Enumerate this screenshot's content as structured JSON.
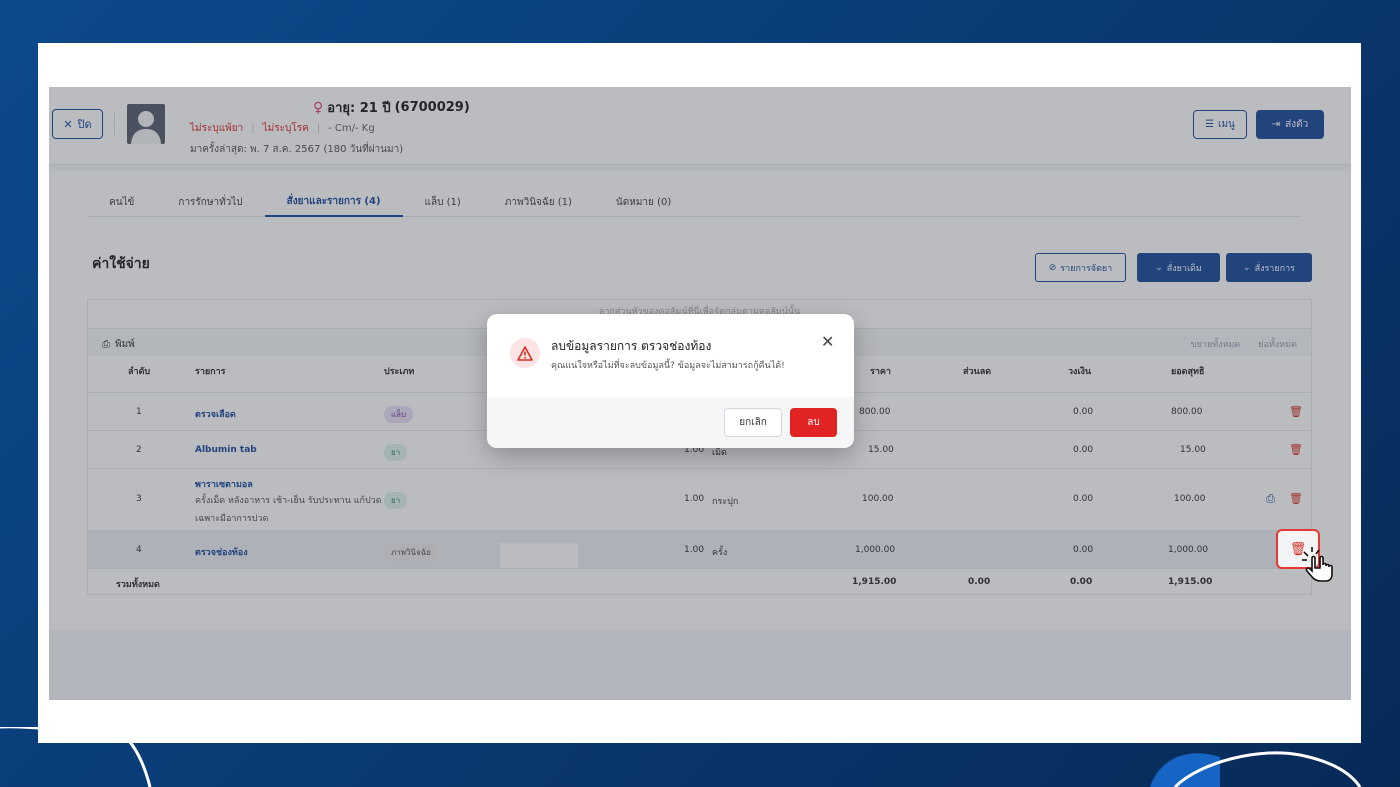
{
  "header": {
    "close_label": "ปิด",
    "age_label": "อายุ: 21 ปี",
    "hn": "(6700029)",
    "tag_allergy": "ไม่ระบุแพ้ยา",
    "tag_disease": "ไม่ระบุโรค",
    "body_metrics": "- Cm/- Kg",
    "last_visit": "มาครั้งล่าสุด: พ. 7 ส.ค. 2567 (180 วันที่ผ่านมา)",
    "menu_label": "เมนู",
    "send_label": "ส่งตัว"
  },
  "tabs": [
    {
      "label": "คนไข้"
    },
    {
      "label": "การรักษาทั่วไป"
    },
    {
      "label": "สั่งยาและรายการ (4)"
    },
    {
      "label": "แล็บ (1)"
    },
    {
      "label": "ภาพวินิจฉัย (1)"
    },
    {
      "label": "นัดหมาย (0)"
    }
  ],
  "section": {
    "title": "ค่าใช้จ่าย",
    "btn_dispense": "รายการจัดยา",
    "btn_reorder": "สั่งยาเดิม",
    "btn_order": "สั่งรายการ",
    "hint": "ลากส่วนหัวของคอลัมน์ที่นี่เพื่อจัดกลุ่มตามคอลัมน์นั้น",
    "print_label": "พิมพ์",
    "expand_all": "ขยายทั้งหมด",
    "collapse_all": "ย่อทั้งหมด"
  },
  "table": {
    "columns": [
      "ลำดับ",
      "รายการ",
      "ประเภท",
      "ราคา",
      "ส่วนลด",
      "วงเงิน",
      "ยอดสุทธิ"
    ],
    "rows": [
      {
        "no": "1",
        "name": "ตรวจเลือด",
        "desc": "",
        "type": "แล็บ",
        "qty": "",
        "unit": "",
        "price": "800.00",
        "limit": "0.00",
        "net": "800.00"
      },
      {
        "no": "2",
        "name": "Albumin tab",
        "desc": "",
        "type": "ยา",
        "qty": "1.00",
        "unit": "เม็ด",
        "price": "15.00",
        "limit": "0.00",
        "net": "15.00"
      },
      {
        "no": "3",
        "name": "พาราเซตามอล",
        "desc": "ครั้งเม็ด หลังอาหาร เช้า-เย็น รับประทาน แก้ปวด",
        "desc2": "เฉพาะมีอาการปวด",
        "type": "ยา",
        "qty": "1.00",
        "unit": "กระปุก",
        "price": "100.00",
        "limit": "0.00",
        "net": "100.00"
      },
      {
        "no": "4",
        "name": "ตรวจช่องท้อง",
        "desc": "",
        "type": "ภาพวินิจฉัย",
        "qty": "1.00",
        "unit": "ครั้ง",
        "price": "1,000.00",
        "limit": "0.00",
        "net": "1,000.00"
      }
    ],
    "footer": {
      "label": "รวมทั้งหมด",
      "price": "1,915.00",
      "discount": "0.00",
      "limit": "0.00",
      "net": "1,915.00"
    }
  },
  "modal": {
    "title": "ลบข้อมูลรายการ ตรวจช่องท้อง",
    "message": "คุณแน่ใจหรือไม่ที่จะลบข้อมูลนี้? ข้อมูลจะไม่สามารถกู้คืนได้!",
    "cancel_label": "ยกเลิก",
    "delete_label": "ลบ"
  },
  "colors": {
    "primary": "#1f4f9c",
    "danger": "#e02424",
    "background": "#0a3a73"
  }
}
